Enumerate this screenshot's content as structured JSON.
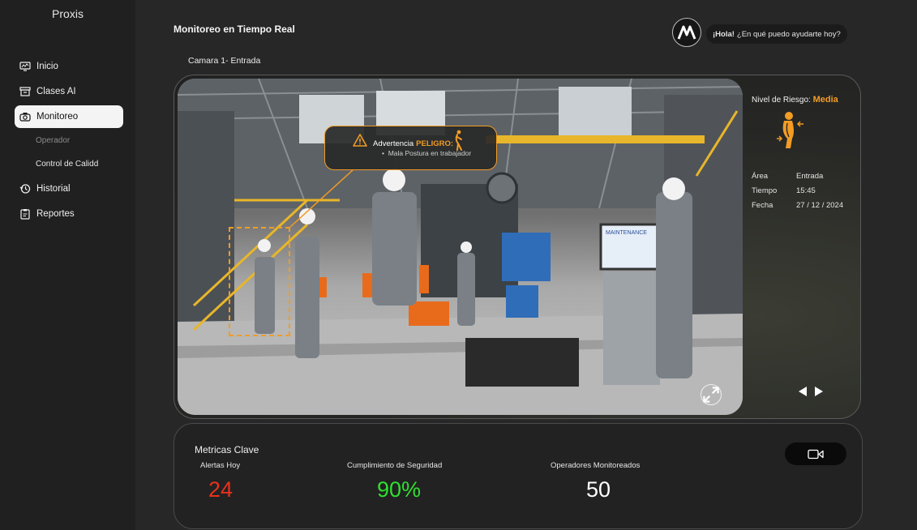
{
  "app": {
    "name": "Proxis"
  },
  "sidebar": {
    "items": [
      {
        "label": "Inicio",
        "icon": "monitor-chart-icon"
      },
      {
        "label": "Clases AI",
        "icon": "archive-box-icon"
      },
      {
        "label": "Monitoreo",
        "icon": "camera-icon",
        "active": true
      },
      {
        "label": "Operador",
        "sub": true
      },
      {
        "label": "Control de Calidd",
        "sub": true
      },
      {
        "label": "Historial",
        "icon": "history-clock-icon"
      },
      {
        "label": "Reportes",
        "icon": "clipboard-icon"
      }
    ]
  },
  "header": {
    "title": "Monitoreo en Tiempo Real",
    "assistant": {
      "greeting": "¡Hola!",
      "message": "¿En qué puedo ayudarte hoy?"
    }
  },
  "camera": {
    "label": "Camara 1- Entrada",
    "alert": {
      "prefix": "Advertencia",
      "level": "PELIGRO:",
      "detail": "Mala Postura en trabajador"
    },
    "scene_text": "MAINTENANCE"
  },
  "info": {
    "risk_label": "Nivel de Riesgo:",
    "risk_value": "Media",
    "area_label": "Área",
    "area_value": "Entrada",
    "time_label": "Tiempo",
    "time_value": "15:45",
    "date_label": "Fecha",
    "date_value": "27 / 12 / 2024"
  },
  "metrics": {
    "title": "Metricas Clave",
    "alerts": {
      "label": "Alertas Hoy",
      "value": "24"
    },
    "compliance": {
      "label": "Cumplimiento de Seguridad",
      "value": "90%"
    },
    "operators": {
      "label": "Operadores Monitoreados",
      "value": "50"
    }
  },
  "colors": {
    "accent": "#f29c24",
    "alert_red": "#e8321c",
    "ok_green": "#2fe02f",
    "active_nav": "#f4f4f4"
  }
}
